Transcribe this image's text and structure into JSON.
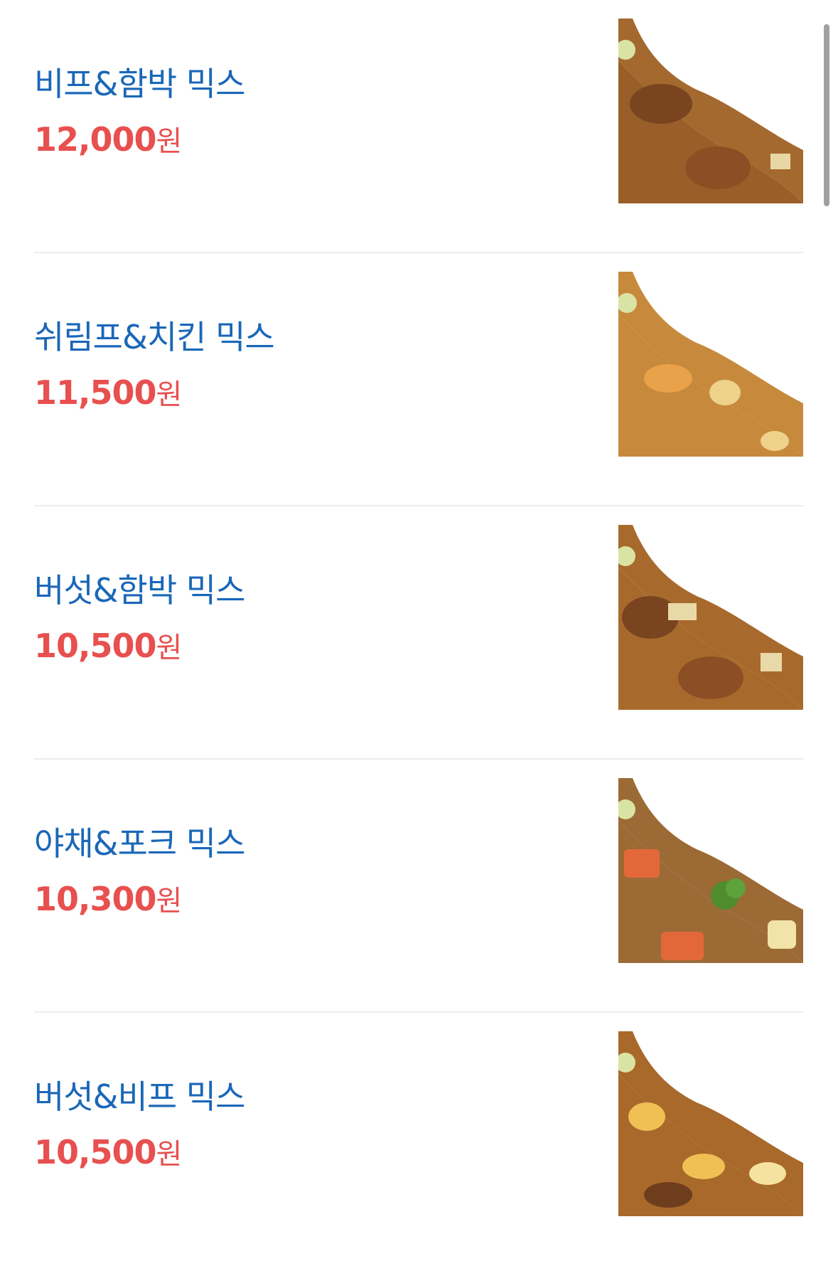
{
  "menu": {
    "items": [
      {
        "name": "비프&함박 믹스",
        "price": "12,000",
        "currency": "원",
        "photo": "beef-hamburg-curry-photo"
      },
      {
        "name": "쉬림프&치킨 믹스",
        "price": "11,500",
        "currency": "원",
        "photo": "shrimp-chicken-curry-photo"
      },
      {
        "name": "버섯&함박 믹스",
        "price": "10,500",
        "currency": "원",
        "photo": "mushroom-hamburg-curry-photo"
      },
      {
        "name": "야채&포크 믹스",
        "price": "10,300",
        "currency": "원",
        "photo": "vegetable-pork-curry-photo"
      },
      {
        "name": "버섯&비프 믹스",
        "price": "10,500",
        "currency": "원",
        "photo": "mushroom-beef-curry-photo"
      }
    ]
  },
  "colors": {
    "name_text": "#1a67b8",
    "price_text": "#e85050",
    "divider": "#ececec",
    "curry": "#a86a2c",
    "rice": "#ffffff"
  }
}
